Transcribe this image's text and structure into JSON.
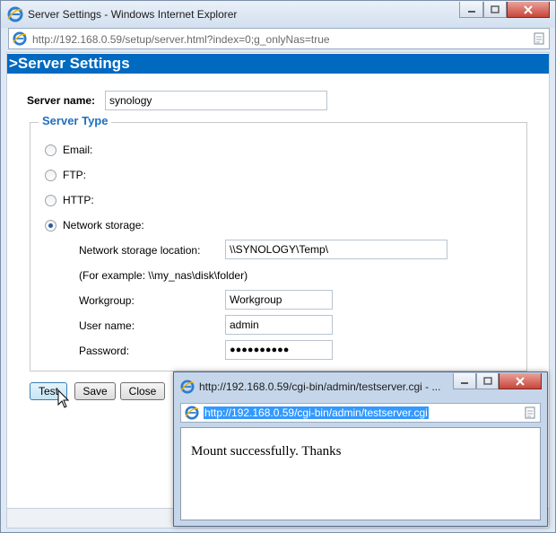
{
  "window": {
    "title": "Server Settings - Windows Internet Explorer",
    "address": "http://192.168.0.59/setup/server.html?index=0;g_onlyNas=true"
  },
  "page": {
    "header": ">Server Settings",
    "server_name_label": "Server name:",
    "server_name_value": "synology",
    "server_type_legend": "Server Type",
    "radios": [
      {
        "label": "Email:",
        "checked": false
      },
      {
        "label": "FTP:",
        "checked": false
      },
      {
        "label": "HTTP:",
        "checked": false
      },
      {
        "label": "Network storage:",
        "checked": true
      }
    ],
    "ns_location_label": "Network storage location:",
    "ns_location_value": "\\\\SYNOLOGY\\Temp\\",
    "example_text": "(For example: \\\\my_nas\\disk\\folder)",
    "workgroup_label": "Workgroup:",
    "workgroup_value": "Workgroup",
    "username_label": "User name:",
    "username_value": "admin",
    "password_label": "Password:",
    "password_value": "●●●●●●●●●●",
    "buttons": {
      "test": "Test",
      "save": "Save",
      "close": "Close"
    }
  },
  "popup": {
    "title": "http://192.168.0.59/cgi-bin/admin/testserver.cgi - ...",
    "address": "http://192.168.0.59/cgi-bin/admin/testserver.cgi",
    "message": "Mount successfully. Thanks"
  },
  "colors": {
    "header_bg": "#0069c0",
    "legend": "#1f6fbf",
    "selection": "#3399ff"
  }
}
